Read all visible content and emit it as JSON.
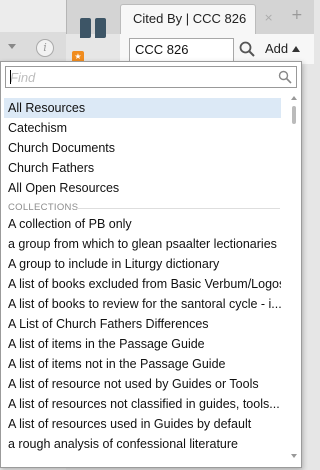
{
  "background": {
    "tab": {
      "title": "Cited By | CCC 826",
      "close_glyph": "×",
      "add_glyph": "+"
    },
    "toolbar": {
      "reference_value": "CCC 826",
      "add_label": "Add"
    },
    "icons": {
      "info": "i",
      "panel_badge": "★"
    }
  },
  "popup": {
    "find_placeholder": "Find",
    "items_top": [
      {
        "label": "All Resources",
        "selected": true
      },
      {
        "label": "Catechism"
      },
      {
        "label": "Church Documents"
      },
      {
        "label": "Church Fathers"
      },
      {
        "label": "All Open Resources"
      }
    ],
    "section_header": "COLLECTIONS",
    "collections": [
      "A collection of PB only",
      "a group from which to glean psaalter lectionaries",
      "A group to include in Liturgy dictionary",
      "A list of books excluded from Basic Verbum/Logos",
      "A list of books to review for the santoral cycle - i...",
      "A List of Church Fathers Differences",
      "A list of items in the Passage Guide",
      "A list of items not in the Passage Guide",
      "A list of resource not used by Guides or Tools",
      "A list of resources not classified in guides, tools...",
      "A list of resources used in Guides by default",
      "a rough analysis of confessional literature"
    ]
  },
  "colors": {
    "selection": "#dce9f6",
    "panel_icon": "#3d5566",
    "badge": "#f08c1e"
  }
}
